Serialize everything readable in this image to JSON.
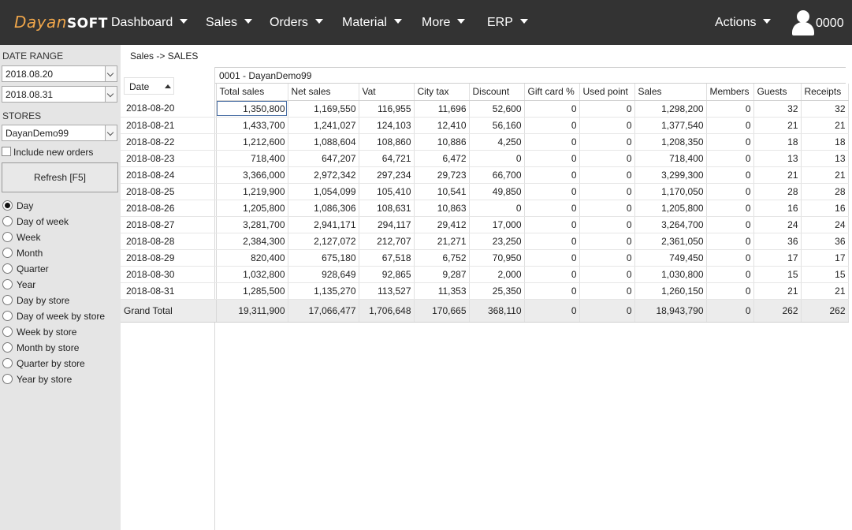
{
  "app": {
    "logo_part1": "Dayan",
    "logo_part2": "SOFT"
  },
  "nav": {
    "items": [
      {
        "label": "Dashboard"
      },
      {
        "label": "Sales"
      },
      {
        "label": "Orders"
      },
      {
        "label": "Material"
      },
      {
        "label": "More"
      },
      {
        "label": "ERP"
      }
    ],
    "actions_label": "Actions",
    "user_name": "0000"
  },
  "sidebar": {
    "date_range_label": "DATE RANGE",
    "date_from": "2018.08.20",
    "date_to": "2018.08.31",
    "stores_label": "STORES",
    "store_value": "DayanDemo99",
    "include_new_orders_label": "Include new orders",
    "include_new_orders_checked": false,
    "refresh_label": "Refresh [F5]",
    "group_options": [
      {
        "label": "Day",
        "selected": true
      },
      {
        "label": "Day of week",
        "selected": false
      },
      {
        "label": "Week",
        "selected": false
      },
      {
        "label": "Month",
        "selected": false
      },
      {
        "label": "Quarter",
        "selected": false
      },
      {
        "label": "Year",
        "selected": false
      },
      {
        "label": "Day by store",
        "selected": false
      },
      {
        "label": "Day of week by store",
        "selected": false
      },
      {
        "label": "Week by store",
        "selected": false
      },
      {
        "label": "Month by store",
        "selected": false
      },
      {
        "label": "Quarter by store",
        "selected": false
      },
      {
        "label": "Year by store",
        "selected": false
      }
    ]
  },
  "main": {
    "breadcrumb": "Sales -> SALES",
    "store_header": "0001 - DayanDemo99",
    "date_column_label": "Date",
    "columns": [
      "Total sales",
      "Net sales",
      "Vat",
      "City tax",
      "Discount",
      "Gift card %",
      "Used point",
      "Sales",
      "Members",
      "Guests",
      "Receipts"
    ],
    "rows": [
      {
        "date": "2018-08-20",
        "cells": [
          "1,350,800",
          "1,169,550",
          "116,955",
          "11,696",
          "52,600",
          "0",
          "0",
          "1,298,200",
          "0",
          "32",
          "32"
        ]
      },
      {
        "date": "2018-08-21",
        "cells": [
          "1,433,700",
          "1,241,027",
          "124,103",
          "12,410",
          "56,160",
          "0",
          "0",
          "1,377,540",
          "0",
          "21",
          "21"
        ]
      },
      {
        "date": "2018-08-22",
        "cells": [
          "1,212,600",
          "1,088,604",
          "108,860",
          "10,886",
          "4,250",
          "0",
          "0",
          "1,208,350",
          "0",
          "18",
          "18"
        ]
      },
      {
        "date": "2018-08-23",
        "cells": [
          "718,400",
          "647,207",
          "64,721",
          "6,472",
          "0",
          "0",
          "0",
          "718,400",
          "0",
          "13",
          "13"
        ]
      },
      {
        "date": "2018-08-24",
        "cells": [
          "3,366,000",
          "2,972,342",
          "297,234",
          "29,723",
          "66,700",
          "0",
          "0",
          "3,299,300",
          "0",
          "21",
          "21"
        ]
      },
      {
        "date": "2018-08-25",
        "cells": [
          "1,219,900",
          "1,054,099",
          "105,410",
          "10,541",
          "49,850",
          "0",
          "0",
          "1,170,050",
          "0",
          "28",
          "28"
        ]
      },
      {
        "date": "2018-08-26",
        "cells": [
          "1,205,800",
          "1,086,306",
          "108,631",
          "10,863",
          "0",
          "0",
          "0",
          "1,205,800",
          "0",
          "16",
          "16"
        ]
      },
      {
        "date": "2018-08-27",
        "cells": [
          "3,281,700",
          "2,941,171",
          "294,117",
          "29,412",
          "17,000",
          "0",
          "0",
          "3,264,700",
          "0",
          "24",
          "24"
        ]
      },
      {
        "date": "2018-08-28",
        "cells": [
          "2,384,300",
          "2,127,072",
          "212,707",
          "21,271",
          "23,250",
          "0",
          "0",
          "2,361,050",
          "0",
          "36",
          "36"
        ]
      },
      {
        "date": "2018-08-29",
        "cells": [
          "820,400",
          "675,180",
          "67,518",
          "6,752",
          "70,950",
          "0",
          "0",
          "749,450",
          "0",
          "17",
          "17"
        ]
      },
      {
        "date": "2018-08-30",
        "cells": [
          "1,032,800",
          "928,649",
          "92,865",
          "9,287",
          "2,000",
          "0",
          "0",
          "1,030,800",
          "0",
          "15",
          "15"
        ]
      },
      {
        "date": "2018-08-31",
        "cells": [
          "1,285,500",
          "1,135,270",
          "113,527",
          "11,353",
          "25,350",
          "0",
          "0",
          "1,260,150",
          "0",
          "21",
          "21"
        ]
      }
    ],
    "total": {
      "label": "Grand Total",
      "cells": [
        "19,311,900",
        "17,066,477",
        "1,706,648",
        "170,665",
        "368,110",
        "0",
        "0",
        "18,943,790",
        "0",
        "262",
        "262"
      ]
    }
  }
}
